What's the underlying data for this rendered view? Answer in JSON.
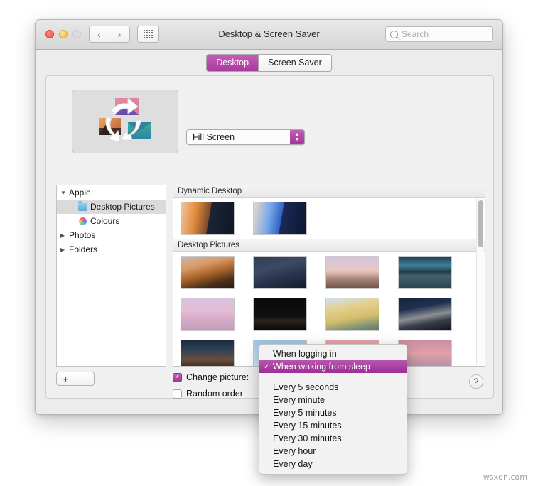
{
  "window": {
    "title": "Desktop & Screen Saver",
    "traffic_lights": [
      "close",
      "minimize",
      "zoom"
    ],
    "nav": {
      "back": "‹",
      "forward": "›"
    },
    "grid_button": "show-all-grid-icon"
  },
  "search": {
    "placeholder": "Search",
    "value": ""
  },
  "tabs": [
    {
      "label": "Desktop",
      "active": true
    },
    {
      "label": "Screen Saver",
      "active": false
    }
  ],
  "preview": {
    "icon_name": "desktop-pictures-rotate-icon"
  },
  "fill_popup": {
    "value": "Fill Screen",
    "options": [
      "Fill Screen"
    ]
  },
  "sidebar": {
    "items": [
      {
        "label": "Apple",
        "level": 0,
        "disclosure": "▼",
        "icon": "none",
        "selected": false
      },
      {
        "label": "Desktop Pictures",
        "level": 1,
        "disclosure": "",
        "icon": "folder",
        "selected": true
      },
      {
        "label": "Colours",
        "level": 1,
        "disclosure": "",
        "icon": "colour-wheel",
        "selected": false
      },
      {
        "label": "Photos",
        "level": 0,
        "disclosure": "▶",
        "icon": "none",
        "selected": false
      },
      {
        "label": "Folders",
        "level": 0,
        "disclosure": "▶",
        "icon": "none",
        "selected": false
      }
    ],
    "add_button": "+",
    "remove_button": "−"
  },
  "browser": {
    "groups": [
      {
        "header": "Dynamic Desktop",
        "thumbnails": [
          {
            "name": "mojave-dynamic",
            "css": "linear-gradient(100deg,#f3c6a2 0%,#e08a3c 28%,#7a4a2a 52%,#1d2436 53%,#0f1626 100%)"
          },
          {
            "name": "solar-gradients-dynamic",
            "css": "linear-gradient(100deg,#e9d9c8 0%,#7ba8e8 30%,#2f63c4 52%,#1b2a55 53%,#0d1430 100%)"
          }
        ]
      },
      {
        "header": "Desktop Pictures",
        "thumbnails": [
          {
            "name": "mojave-day",
            "css": "linear-gradient(165deg,#cbb7b0 0%,#d99a63 30%,#a35f27 55%,#4a2f1c 78%,#2a1a12 100%)"
          },
          {
            "name": "mojave-night",
            "css": "linear-gradient(165deg,#2d3a52 0%,#3b4a66 35%,#27324a 65%,#151c2c 100%)"
          },
          {
            "name": "solar-cave",
            "css": "linear-gradient(180deg,#d3c4e4 0%,#e8c6c0 45%,#a98478 70%,#6a5248 100%)"
          },
          {
            "name": "death-valley-night",
            "css": "linear-gradient(180deg,#1e3b52 0%,#3f7f9a 28%,#233a46 48%,#44626e 60%,#2b4450 100%)"
          },
          {
            "name": "salt-flat-pink",
            "css": "linear-gradient(180deg,#d9c2e2 0%,#e4bcd4 40%,#d2a8c4 70%,#c79cba 100%)"
          },
          {
            "name": "desert-rocks-night",
            "css": "linear-gradient(180deg,#090909 0%,#101010 55%,#2a2420 70%,#060606 100%)"
          },
          {
            "name": "sand-dunes-day",
            "css": "linear-gradient(170deg,#cfe2ec 0%,#e3cf8e 30%,#d4bd6c 60%,#7b8f74 85%,#5c7a68 100%)"
          },
          {
            "name": "dune-ridge-night",
            "css": "linear-gradient(170deg,#16233c 0%,#203150 30%,#8d8f93 55%,#3a3f4a 72%,#0c1220 100%)"
          },
          {
            "name": "desert-mesa-dusk",
            "css": "linear-gradient(180deg,#1b2b3c 0%,#2f4256 30%,#6a4c3c 60%,#1c1410 100%)"
          },
          {
            "name": "blue-sky-clouds",
            "css": "linear-gradient(180deg,#9ec6e8 0%,#c8dcef 50%,#e4eef7 100%)"
          },
          {
            "name": "pink-sunset-clouds",
            "css": "linear-gradient(180deg,#e8a0a8 0%,#f0b9b4 45%,#cfa8b4 100%)"
          },
          {
            "name": "purple-sunset-clouds",
            "css": "linear-gradient(180deg,#c88ea0 0%,#e0a2a8 40%,#a184a8 100%)"
          }
        ]
      }
    ],
    "scrollbar": "vertical-scrollbar"
  },
  "checkboxes": [
    {
      "label": "Change picture:",
      "checked": true
    },
    {
      "label": "Random order",
      "checked": false
    }
  ],
  "help_button": {
    "label": "?"
  },
  "dropdown": {
    "items": [
      {
        "label": "When logging in",
        "checked": false,
        "highlighted": false
      },
      {
        "label": "When waking from sleep",
        "checked": true,
        "highlighted": true
      },
      {
        "separator": true
      },
      {
        "label": "Every 5 seconds",
        "checked": false,
        "highlighted": false
      },
      {
        "label": "Every minute",
        "checked": false,
        "highlighted": false
      },
      {
        "label": "Every 5 minutes",
        "checked": false,
        "highlighted": false
      },
      {
        "label": "Every 15 minutes",
        "checked": false,
        "highlighted": false
      },
      {
        "label": "Every 30 minutes",
        "checked": false,
        "highlighted": false
      },
      {
        "label": "Every hour",
        "checked": false,
        "highlighted": false
      },
      {
        "label": "Every day",
        "checked": false,
        "highlighted": false
      }
    ],
    "check_glyph": "✓"
  },
  "watermark": "wsxdn.com",
  "colors": {
    "accent": "#a4359a",
    "accent_light": "#c05fb4",
    "window_bg": "#ececec"
  }
}
